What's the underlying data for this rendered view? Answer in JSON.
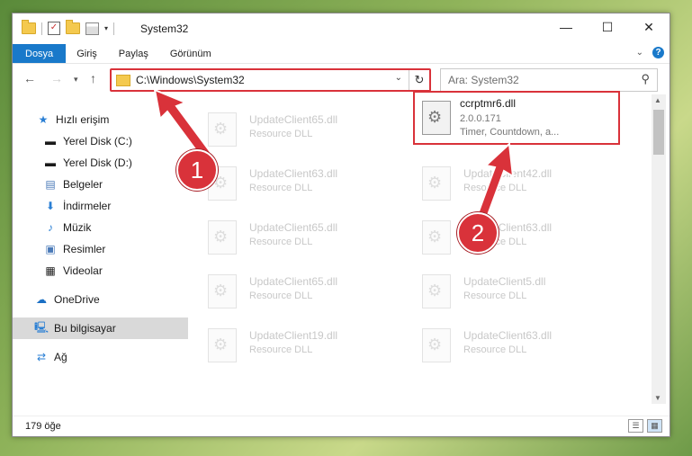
{
  "window": {
    "title": "System32",
    "controls": {
      "minimize": "—",
      "maximize": "☐",
      "close": "✕"
    }
  },
  "menu": {
    "items": [
      "Dosya",
      "Giriş",
      "Paylaş",
      "Görünüm"
    ],
    "help": "?"
  },
  "address": {
    "path": "C:\\Windows\\System32"
  },
  "search": {
    "placeholder": "Ara: System32"
  },
  "nav": {
    "items": [
      {
        "label": "Hızlı erişim",
        "icon": "star-icon",
        "pinned": false
      },
      {
        "label": "Yerel Disk (C:)",
        "icon": "drive-icon",
        "pinned": true
      },
      {
        "label": "Yerel Disk (D:)",
        "icon": "drive-icon",
        "pinned": true
      },
      {
        "label": "Belgeler",
        "icon": "documents-icon",
        "pinned": true
      },
      {
        "label": "İndirmeler",
        "icon": "download-icon",
        "pinned": true
      },
      {
        "label": "Müzik",
        "icon": "music-icon",
        "pinned": true
      },
      {
        "label": "Resimler",
        "icon": "pictures-icon",
        "pinned": true
      },
      {
        "label": "Videolar",
        "icon": "videos-icon",
        "pinned": true
      },
      {
        "label": "OneDrive",
        "icon": "cloud-icon",
        "pinned": false
      },
      {
        "label": "Bu bilgisayar",
        "icon": "computer-icon",
        "pinned": false,
        "selected": true
      },
      {
        "label": "Ağ",
        "icon": "network-icon",
        "pinned": false
      }
    ]
  },
  "files": {
    "highlighted": {
      "name": "ccrptmr6.dll",
      "version": "2.0.0.171",
      "description": "Timer, Countdown, a..."
    },
    "left_column": [
      {
        "name": "UpdateClient65.dll",
        "desc": "Resource DLL"
      },
      {
        "name": "UpdateClient63.dll",
        "desc": "Resource DLL"
      },
      {
        "name": "UpdateClient65.dll",
        "desc": "Resource DLL"
      },
      {
        "name": "UpdateClient65.dll",
        "desc": "Resource DLL"
      },
      {
        "name": "UpdateClient19.dll",
        "desc": "Resource DLL"
      }
    ],
    "right_column": [
      {
        "name": "UpdateClient42.dll",
        "desc": "Resource DLL"
      },
      {
        "name": "UpdateClient63.dll",
        "desc": "Resource DLL"
      },
      {
        "name": "UpdateClient5.dll",
        "desc": "Resource DLL"
      },
      {
        "name": "UpdateClient63.dll",
        "desc": "Resource DLL"
      }
    ]
  },
  "status": {
    "count": "179 öğe"
  },
  "annotations": {
    "step1": "1",
    "step2": "2",
    "color": "#d9323a"
  }
}
